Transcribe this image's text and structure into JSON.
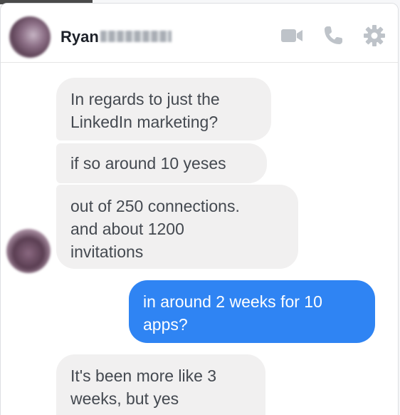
{
  "header": {
    "contact_name": "Ryan",
    "icons": [
      "video-camera-icon",
      "phone-icon",
      "gear-icon"
    ],
    "icon_color": "#bec3c9"
  },
  "messages": [
    {
      "sender": "contact",
      "text": "In regards to just the\nLinkedIn marketing?"
    },
    {
      "sender": "contact",
      "text": "if so around 10 yeses"
    },
    {
      "sender": "contact",
      "text": "out of 250 connections.\nand about 1200\ninvitations"
    },
    {
      "sender": "me",
      "text": "in around 2 weeks for 10\napps?"
    },
    {
      "sender": "contact",
      "text": "It's been more like 3\nweeks, but yes"
    }
  ],
  "colors": {
    "incoming_bubble": "#f1f0f0",
    "outgoing_bubble": "#2f84f3",
    "incoming_text": "#444950",
    "outgoing_text": "#ffffff"
  }
}
